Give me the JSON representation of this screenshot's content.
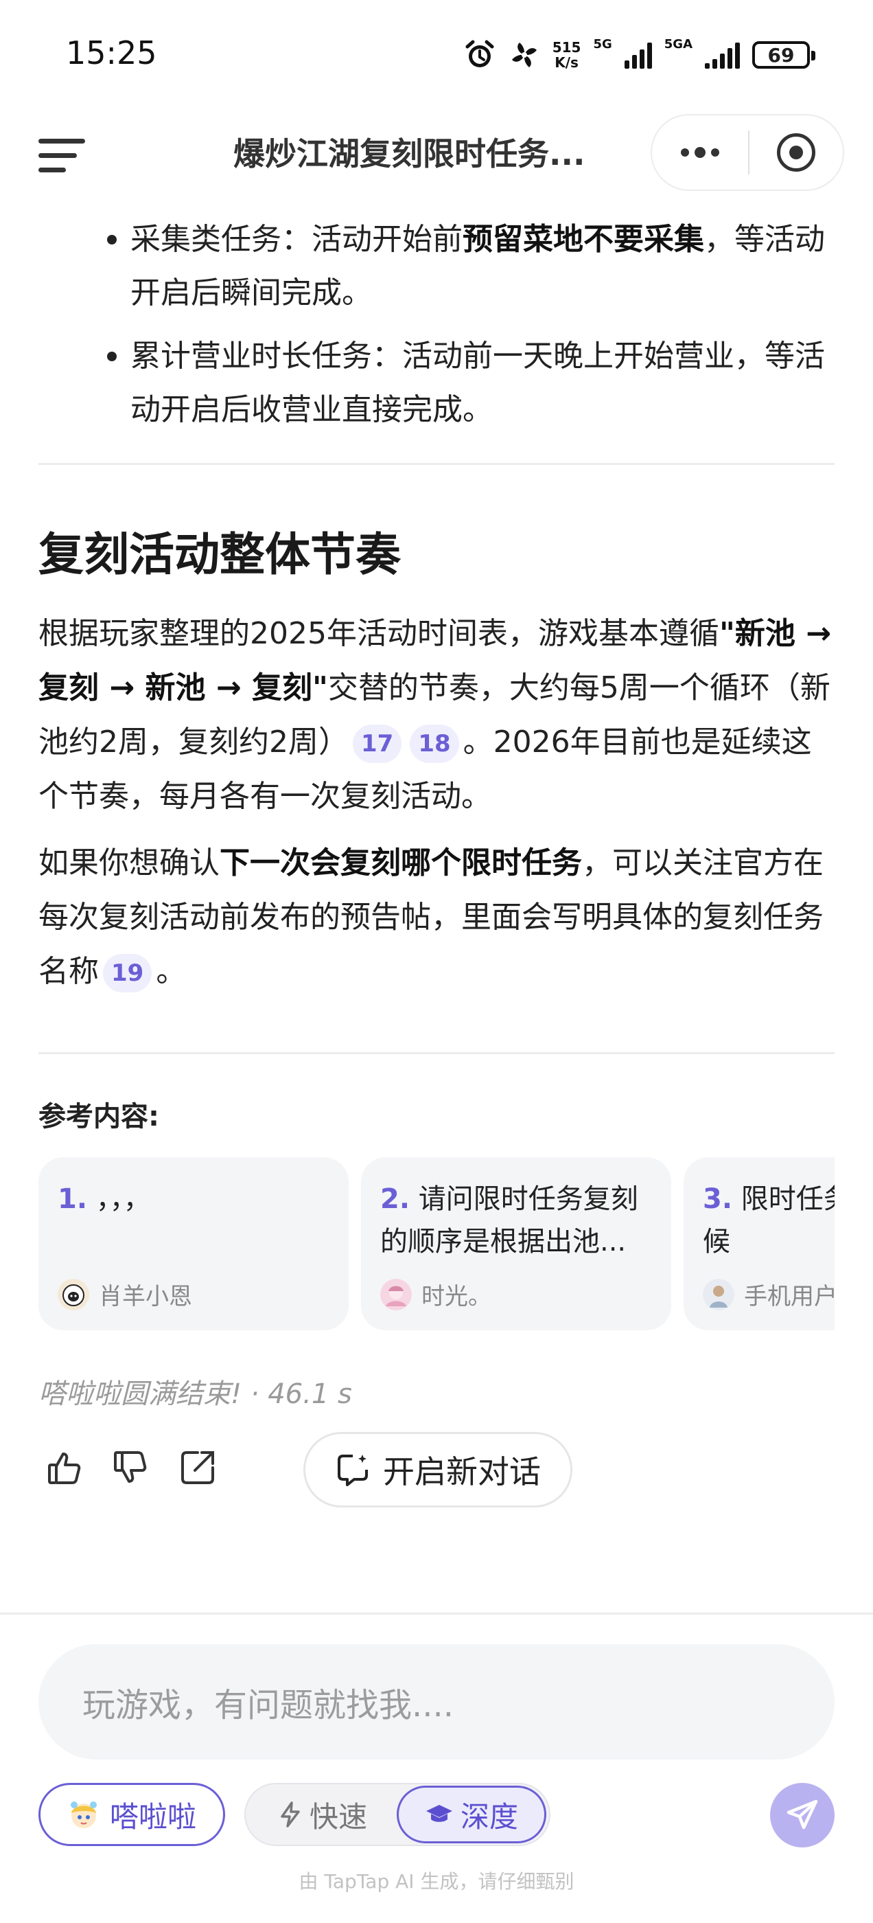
{
  "status_bar": {
    "time": "15:25",
    "speed_value": "515",
    "speed_unit": "K/s",
    "net1": "5G",
    "net2": "5GA",
    "battery": "69"
  },
  "header": {
    "title": "爆炒江湖复刻限时任务..."
  },
  "bullets": [
    {
      "pre": "采集类任务：活动开始前",
      "bold": "预留菜地不要采集",
      "post": "，等活动开启后瞬间完成。"
    },
    {
      "pre": "累计营业时长任务：活动前一天晚上开始营业，等活动开启后收营业直接完成。",
      "bold": "",
      "post": ""
    }
  ],
  "section": {
    "title": "复刻活动整体节奏",
    "p1_a": "根据玩家整理的2025年活动时间表，游戏基本遵循",
    "p1_bold": "\"新池 → 复刻 → 新池 → 复刻\"",
    "p1_b": "交替的节奏，大约每5周一个循环（新池约2周，复刻约2周）",
    "cite17": "17",
    "cite18": "18",
    "p1_c": "。2026年目前也是延续这个节奏，每月各有一次复刻活动。",
    "p2_a": "如果你想确认",
    "p2_bold": "下一次会复刻哪个限时任务",
    "p2_b": "，可以关注官方在每次复刻活动前发布的预告帖，里面会写明具体的复刻任务名称",
    "cite19": "19",
    "p2_c": "。"
  },
  "references": {
    "title": "参考内容:",
    "items": [
      {
        "num": "1.",
        "text": "，，，",
        "author": "肖羊小恩"
      },
      {
        "num": "2.",
        "text": "请问限时任务复刻的顺序是根据出池...",
        "author": "时光。"
      },
      {
        "num": "3.",
        "text": "限时任务复刻的时候",
        "author": "手机用户"
      }
    ]
  },
  "meta": {
    "status": "嗒啦啦圆满结束!",
    "sep": "·",
    "duration": "46.1 s"
  },
  "actions": {
    "new_chat": "开启新对话"
  },
  "input": {
    "placeholder": "玩游戏，有问题就找我...."
  },
  "bottom": {
    "assistant_name": "嗒啦啦",
    "mode_fast": "快速",
    "mode_deep": "深度",
    "footer": "由 TapTap AI 生成，请仔细甄别"
  },
  "colors": {
    "accent": "#6b5fd6",
    "send_button": "#b9b2f0"
  }
}
